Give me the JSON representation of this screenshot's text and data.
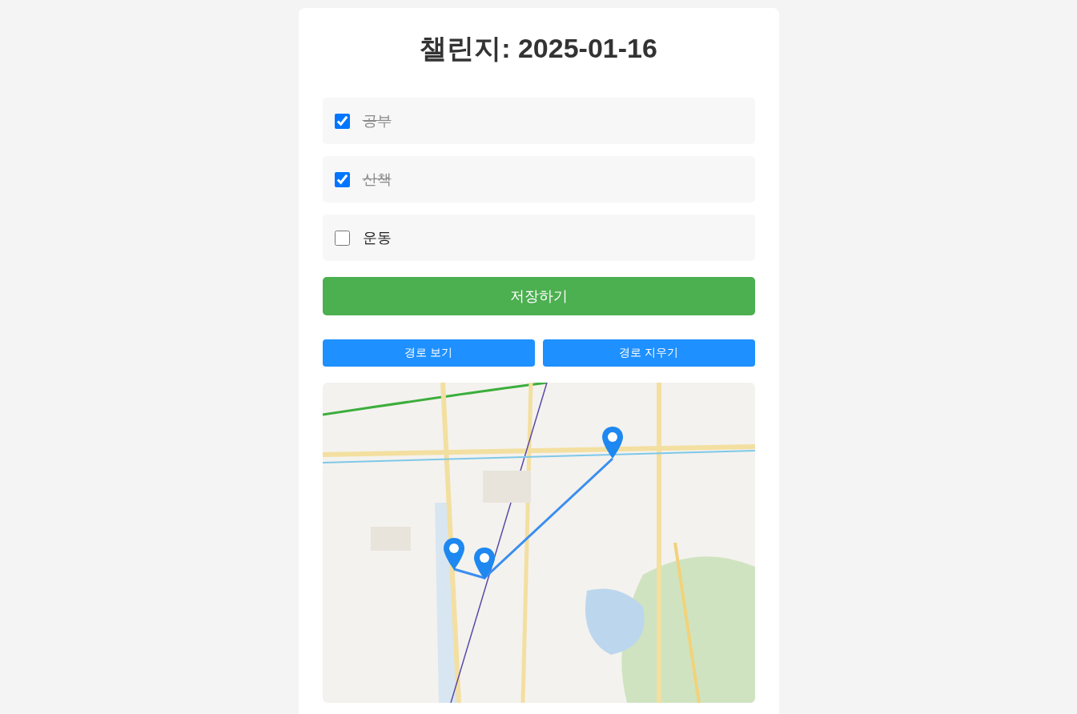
{
  "title": "챌린지: 2025-01-16",
  "tasks": [
    {
      "label": "공부",
      "checked": true
    },
    {
      "label": "산책",
      "checked": true
    },
    {
      "label": "운동",
      "checked": false
    }
  ],
  "save_button": "저장하기",
  "route_buttons": [
    "경로 보기",
    "경로 지우기"
  ],
  "map": {
    "kind": "picture"
  }
}
